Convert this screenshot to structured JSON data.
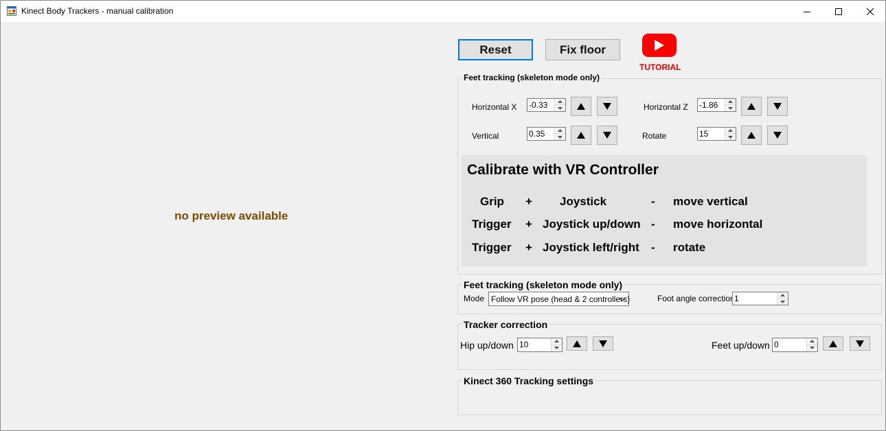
{
  "window": {
    "title": "Kinect Body Trackers - manual calibration"
  },
  "preview": {
    "text": "no preview available"
  },
  "toolbar": {
    "reset_label": "Reset",
    "fix_floor_label": "Fix floor",
    "tutorial_label": "TUTORIAL"
  },
  "feet_group1": {
    "title": "Feet tracking (skeleton mode only)",
    "horizontal_x": {
      "label": "Horizontal X",
      "value": "-0.33"
    },
    "horizontal_z": {
      "label": "Horizontal Z",
      "value": "-1.86"
    },
    "vertical": {
      "label": "Vertical",
      "value": "0.35"
    },
    "rotate": {
      "label": "Rotate",
      "value": "15"
    }
  },
  "vr_calibration": {
    "title": "Calibrate with VR Controller",
    "rows": [
      {
        "button": "Grip",
        "plus": "+",
        "action": "Joystick",
        "dash": "-",
        "effect": "move vertical"
      },
      {
        "button": "Trigger",
        "plus": "+",
        "action": "Joystick up/down",
        "dash": "-",
        "effect": "move horizontal"
      },
      {
        "button": "Trigger",
        "plus": "+",
        "action": "Joystick left/right",
        "dash": "-",
        "effect": "rotate"
      }
    ]
  },
  "feet_group2": {
    "title": "Feet tracking (skeleton mode only)",
    "mode_label": "Mode",
    "mode_value": "Follow VR pose (head & 2 controllers)",
    "foot_angle_label": "Foot angle correction",
    "foot_angle_value": "1"
  },
  "tracker_correction": {
    "title": "Tracker correction",
    "hip_label": "Hip up/down",
    "hip_value": "10",
    "feet_label": "Feet up/down",
    "feet_value": "0"
  },
  "kinect360": {
    "title": "Kinect 360 Tracking settings"
  },
  "colors": {
    "accent": "#0078d7",
    "youtube_red": "#ff0000",
    "preview_text": "#7a4a00"
  },
  "icons": {
    "up_arrow": "triangle-up",
    "down_arrow": "triangle-down",
    "youtube": "youtube-play"
  }
}
